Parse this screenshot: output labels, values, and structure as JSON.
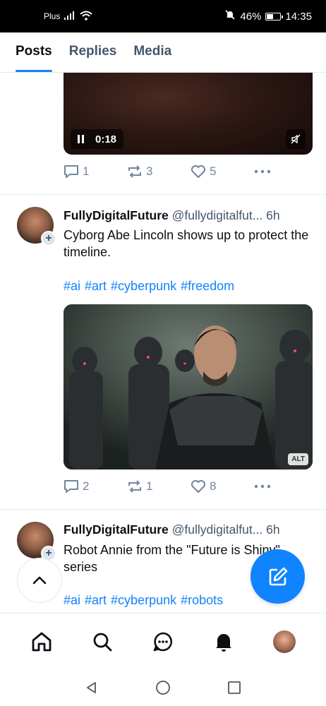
{
  "status_bar": {
    "carrier": "Plus",
    "battery_percent": "46%",
    "time": "14:35",
    "icons": [
      "signal-icon",
      "wifi-icon",
      "mute-bell-icon",
      "battery-icon"
    ]
  },
  "tabs": [
    {
      "label": "Posts",
      "active": true
    },
    {
      "label": "Replies",
      "active": false
    },
    {
      "label": "Media",
      "active": false
    }
  ],
  "feed": {
    "video_post": {
      "video_time": "0:18",
      "replies": "1",
      "reposts": "3",
      "likes": "5"
    },
    "posts": [
      {
        "display_name": "FullyDigitalFuture",
        "handle": "@fullydigitalfut...",
        "time": "6h",
        "text": "Cyborg Abe Lincoln shows up to protect the timeline.",
        "hashtags": "#ai #art #cyberpunk #freedom",
        "alt_badge": "ALT",
        "replies": "2",
        "reposts": "1",
        "likes": "8"
      },
      {
        "display_name": "FullyDigitalFuture",
        "handle": "@fullydigitalfut...",
        "time": "6h",
        "text": "Robot Annie from the \"Future is Shiny\" series",
        "hashtags": "#ai #art #cyberpunk #robots"
      }
    ]
  },
  "bottom_nav": [
    "home-icon",
    "search-icon",
    "chat-icon",
    "notifications-icon",
    "profile-avatar"
  ],
  "colors": {
    "accent": "#1083fe",
    "muted": "#6f869f",
    "text": "#0b0f14"
  }
}
